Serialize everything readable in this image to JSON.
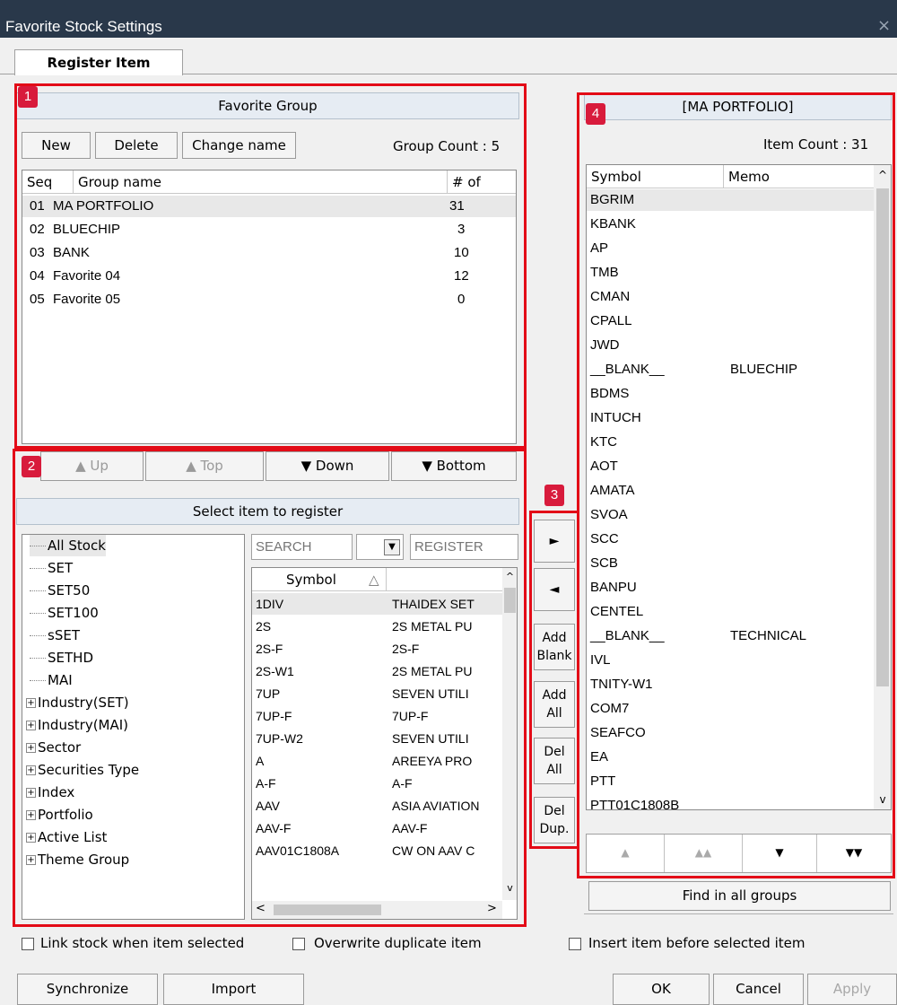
{
  "window": {
    "title": "Favorite Stock Settings",
    "close": "×"
  },
  "tabs": [
    {
      "label": "Register Item"
    }
  ],
  "favorite_group": {
    "badge": "1",
    "header": "Favorite Group",
    "buttons": {
      "new": "New",
      "delete": "Delete",
      "change_name": "Change name"
    },
    "group_count": "Group Count : 5",
    "columns": [
      "Seq",
      "Group name",
      "# of items"
    ],
    "rows": [
      {
        "seq": "01",
        "name": "MA PORTFOLIO",
        "items": "31"
      },
      {
        "seq": "02",
        "name": "BLUECHIP",
        "items": "3"
      },
      {
        "seq": "03",
        "name": "BANK",
        "items": "10"
      },
      {
        "seq": "04",
        "name": "Favorite 04",
        "items": "12"
      },
      {
        "seq": "05",
        "name": "Favorite 05",
        "items": "0"
      }
    ]
  },
  "move_bar": {
    "badge": "2",
    "up": "▲ Up",
    "top": "▲ Top",
    "down": "▼ Down",
    "bottom": "▼ Bottom"
  },
  "select_panel": {
    "header": "Select item to register",
    "tree": [
      {
        "label": "All Stock",
        "expandable": false
      },
      {
        "label": "SET",
        "expandable": false
      },
      {
        "label": "SET50",
        "expandable": false
      },
      {
        "label": "SET100",
        "expandable": false
      },
      {
        "label": "sSET",
        "expandable": false
      },
      {
        "label": "SETHD",
        "expandable": false
      },
      {
        "label": "MAI",
        "expandable": false
      },
      {
        "label": "Industry(SET)",
        "expandable": true
      },
      {
        "label": "Industry(MAI)",
        "expandable": true
      },
      {
        "label": "Sector",
        "expandable": true
      },
      {
        "label": "Securities Type",
        "expandable": true
      },
      {
        "label": "Index",
        "expandable": true
      },
      {
        "label": "Portfolio",
        "expandable": true
      },
      {
        "label": "Active List",
        "expandable": true
      },
      {
        "label": "Theme Group",
        "expandable": true
      }
    ],
    "search_placeholder": "SEARCH",
    "register_placeholder": "REGISTER",
    "symbol_header": "Symbol",
    "sort_icon": "△",
    "stocks": [
      {
        "symbol": "1DIV",
        "name": "THAIDEX SET"
      },
      {
        "symbol": "2S",
        "name": "2S METAL PU"
      },
      {
        "symbol": "2S-F",
        "name": "2S-F"
      },
      {
        "symbol": "2S-W1",
        "name": "2S METAL PU"
      },
      {
        "symbol": "7UP",
        "name": "SEVEN UTILI"
      },
      {
        "symbol": "7UP-F",
        "name": "7UP-F"
      },
      {
        "symbol": "7UP-W2",
        "name": "SEVEN UTILI"
      },
      {
        "symbol": "A",
        "name": "AREEYA PRO"
      },
      {
        "symbol": "A-F",
        "name": "A-F"
      },
      {
        "symbol": "AAV",
        "name": "ASIA AVIATION"
      },
      {
        "symbol": "AAV-F",
        "name": "AAV-F"
      },
      {
        "symbol": "AAV01C1808A",
        "name": "CW ON AAV C"
      }
    ]
  },
  "transfer": {
    "badge": "3",
    "add": "►",
    "remove": "◄",
    "add_blank": [
      "Add",
      "Blank"
    ],
    "add_all": [
      "Add",
      "All"
    ],
    "del_all": [
      "Del",
      "All"
    ],
    "del_dup": [
      "Del",
      "Dup."
    ]
  },
  "portfolio": {
    "badge": "4",
    "header": "[MA PORTFOLIO]",
    "item_count": "Item Count : 31",
    "columns": [
      "Symbol",
      "Memo"
    ],
    "rows": [
      {
        "symbol": "BGRIM",
        "memo": ""
      },
      {
        "symbol": "KBANK",
        "memo": ""
      },
      {
        "symbol": "AP",
        "memo": ""
      },
      {
        "symbol": "TMB",
        "memo": ""
      },
      {
        "symbol": "CMAN",
        "memo": ""
      },
      {
        "symbol": "CPALL",
        "memo": ""
      },
      {
        "symbol": "JWD",
        "memo": ""
      },
      {
        "symbol": "__BLANK__",
        "memo": "BLUECHIP"
      },
      {
        "symbol": "BDMS",
        "memo": ""
      },
      {
        "symbol": "INTUCH",
        "memo": ""
      },
      {
        "symbol": "KTC",
        "memo": ""
      },
      {
        "symbol": "AOT",
        "memo": ""
      },
      {
        "symbol": "AMATA",
        "memo": ""
      },
      {
        "symbol": "SVOA",
        "memo": ""
      },
      {
        "symbol": "SCC",
        "memo": ""
      },
      {
        "symbol": "SCB",
        "memo": ""
      },
      {
        "symbol": "BANPU",
        "memo": ""
      },
      {
        "symbol": "CENTEL",
        "memo": ""
      },
      {
        "symbol": "__BLANK__",
        "memo": "TECHNICAL"
      },
      {
        "symbol": "IVL",
        "memo": ""
      },
      {
        "symbol": "TNITY-W1",
        "memo": ""
      },
      {
        "symbol": "COM7",
        "memo": ""
      },
      {
        "symbol": "SEAFCO",
        "memo": ""
      },
      {
        "symbol": "EA",
        "memo": ""
      },
      {
        "symbol": "PTT",
        "memo": ""
      },
      {
        "symbol": "PTT01C1808B",
        "memo": ""
      }
    ],
    "move": {
      "up": "▲",
      "top": "▲▲",
      "down": "▼",
      "bottom": "▼▼"
    },
    "find": "Find in all groups"
  },
  "options": {
    "link": "Link stock when item selected",
    "overwrite": "Overwrite duplicate item",
    "insert": "Insert item before selected item"
  },
  "footer": {
    "synchronize": "Synchronize",
    "import": "Import",
    "ok": "OK",
    "cancel": "Cancel",
    "apply": "Apply"
  },
  "colors": {
    "highlight": "#e30b17",
    "badge": "#d81b3c",
    "titlebar": "#29384a"
  }
}
